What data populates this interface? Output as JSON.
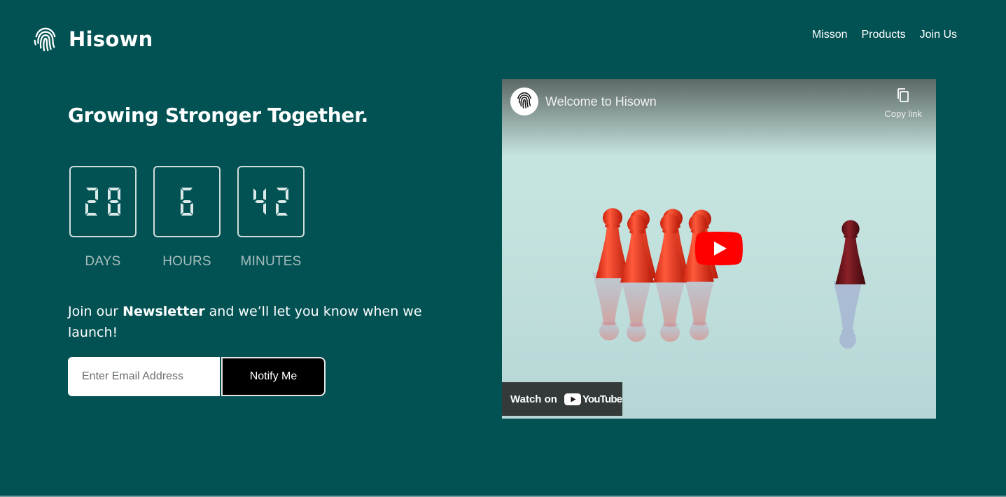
{
  "brand": {
    "name": "Hisown",
    "logo_icon": "fingerprint-icon"
  },
  "nav": {
    "items": [
      "Misson",
      "Products",
      "Join Us"
    ]
  },
  "hero": {
    "headline": "Growing Stronger Together."
  },
  "countdown": [
    {
      "value": "28",
      "label": "DAYS"
    },
    {
      "value": "6",
      "label": "HOURS"
    },
    {
      "value": "42",
      "label": "MINUTES"
    }
  ],
  "newsletter": {
    "text_before": "Join our ",
    "text_bold": "Newsletter",
    "text_after": " and we’ll let you know when we launch!",
    "email_placeholder": "Enter Email Address",
    "button_label": "Notify Me"
  },
  "video": {
    "title": "Welcome to Hisown",
    "copy_link_label": "Copy link",
    "copy_icon": "copy-icon",
    "play_icon": "youtube-play-icon",
    "watch_on_label": "Watch on",
    "youtube_wordmark": "YouTube"
  },
  "colors": {
    "background": "#025254",
    "button": "#000000",
    "youtube_red": "#ff0000"
  }
}
